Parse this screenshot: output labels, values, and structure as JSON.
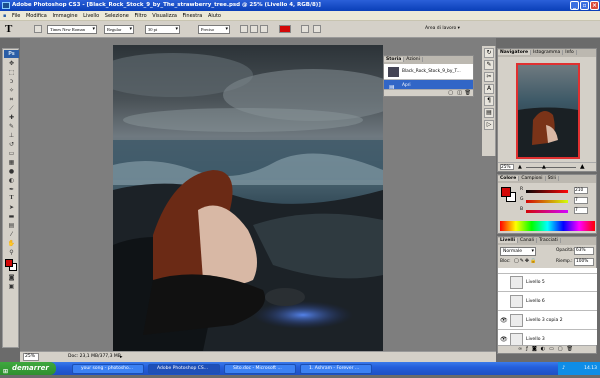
{
  "title": "Adobe Photoshop CS3 - [Black_Rock_Stock_9_by_The_strawberry_tree.psd @ 25% (Livello 4, RGB/8)]",
  "menu": [
    "File",
    "Modifica",
    "Immagine",
    "Livello",
    "Selezione",
    "Filtro",
    "Visualizza",
    "Finestra",
    "Aiuto"
  ],
  "options": {
    "font_family": "Times New Roman",
    "font_style": "Regular",
    "font_size": "30 pt",
    "antialias": "Preciso",
    "workspace": "Area di lavoro ▾"
  },
  "history": {
    "tabs": [
      "Storia",
      "Azioni"
    ],
    "snapshot": "Black_Rock_Stock_9_by_T...",
    "action": "Apri"
  },
  "navigator": {
    "tabs": [
      "Navigatore",
      "Istogramma",
      "Info"
    ],
    "zoom": "25%"
  },
  "color": {
    "tabs": [
      "Colore",
      "Campioni",
      "Stili"
    ],
    "r": "210",
    "g": "7",
    "b": "7",
    "fg_color": "#d20707"
  },
  "layers": {
    "tabs": [
      "Livelli",
      "Canali",
      "Tracciati"
    ],
    "blend": "Normale",
    "opacity_label": "Opacità:",
    "opacity": "63%",
    "lock_label": "Bloc:",
    "fill_label": "Riemp.:",
    "fill": "100%",
    "items": [
      {
        "name": "Livello 5",
        "visible": false
      },
      {
        "name": "Livello 6",
        "visible": false
      },
      {
        "name": "Livello 3 copia 2",
        "visible": true
      },
      {
        "name": "Livello 3",
        "visible": true
      }
    ]
  },
  "status": {
    "zoom": "25%",
    "doc": "Doc: 23,1 MB/377,3 MB"
  },
  "taskbar": {
    "start": "demarrer",
    "tasks": [
      "your song - photosho...",
      "Adobe Photoshop CS...",
      "Sito.doc - Microsoft ...",
      "1. Ashram - Forever ..."
    ],
    "time": "14.13"
  }
}
